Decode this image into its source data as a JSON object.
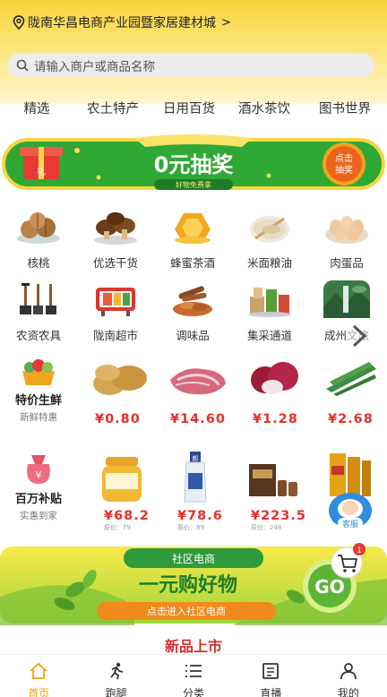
{
  "location": {
    "text": "陇南华昌电商产业园暨家居建材城",
    "chevron": ">"
  },
  "search": {
    "placeholder": "请输入商户或商品名称"
  },
  "categories": [
    "精选",
    "农土特产",
    "日用百货",
    "酒水茶饮",
    "图书世界"
  ],
  "lottery": {
    "title": "0元抽奖",
    "subtitle": "好物免费拿",
    "button_line1": "点击",
    "button_line2": "抽奖"
  },
  "grid_row1": [
    {
      "label": "核桃",
      "icon": "walnut-icon"
    },
    {
      "label": "优选干货",
      "icon": "mushroom-icon"
    },
    {
      "label": "蜂蜜茶酒",
      "icon": "honey-icon"
    },
    {
      "label": "米面粮油",
      "icon": "grain-icon"
    },
    {
      "label": "肉蛋品",
      "icon": "eggs-icon"
    }
  ],
  "grid_row2": [
    {
      "label": "农资农具",
      "icon": "tools-icon"
    },
    {
      "label": "陇南超市",
      "icon": "supermarket-icon"
    },
    {
      "label": "调味品",
      "icon": "spice-icon"
    },
    {
      "label": "集采通道",
      "icon": "bulk-goods-icon"
    },
    {
      "label": "成州文旅",
      "icon": "scenery-icon"
    }
  ],
  "fresh": {
    "title": "特价生鲜",
    "subtitle": "新鲜特惠",
    "items": [
      {
        "price": "¥0.80",
        "icon": "potato-icon"
      },
      {
        "price": "¥14.60",
        "icon": "meat-icon"
      },
      {
        "price": "¥1.28",
        "icon": "onion-icon"
      },
      {
        "price": "¥2.68",
        "icon": "okra-icon"
      }
    ]
  },
  "subsidy": {
    "title": "百万补贴",
    "subtitle": "实惠到家",
    "items": [
      {
        "price": "¥68.2",
        "orig": "原价：79",
        "icon": "honey-jar-icon"
      },
      {
        "price": "¥78.6",
        "orig": "原价：89",
        "icon": "liquor-bottle-icon"
      },
      {
        "price": "¥223.5",
        "orig": "原价：248",
        "icon": "tea-box-icon"
      },
      {
        "price": "",
        "orig": "",
        "icon": "gift-box-icon"
      }
    ]
  },
  "customer_service": {
    "label": "客服"
  },
  "cart": {
    "badge": "1"
  },
  "community": {
    "tag": "社区电商",
    "headline": "一元购好物",
    "button": "点击进入社区电商",
    "go": "GO"
  },
  "new_products": {
    "title": "新品上市"
  },
  "tabs": [
    {
      "label": "首页",
      "icon": "home-icon",
      "active": true
    },
    {
      "label": "跑腿",
      "icon": "runner-icon",
      "active": false
    },
    {
      "label": "分类",
      "icon": "list-icon",
      "active": false
    },
    {
      "label": "直播",
      "icon": "live-icon",
      "active": false
    },
    {
      "label": "我的",
      "icon": "user-icon",
      "active": false
    }
  ],
  "colors": {
    "brand_yellow": "#fad43a",
    "green": "#2fa836",
    "price_red": "#e5302a",
    "active_tab": "#f2a400"
  }
}
